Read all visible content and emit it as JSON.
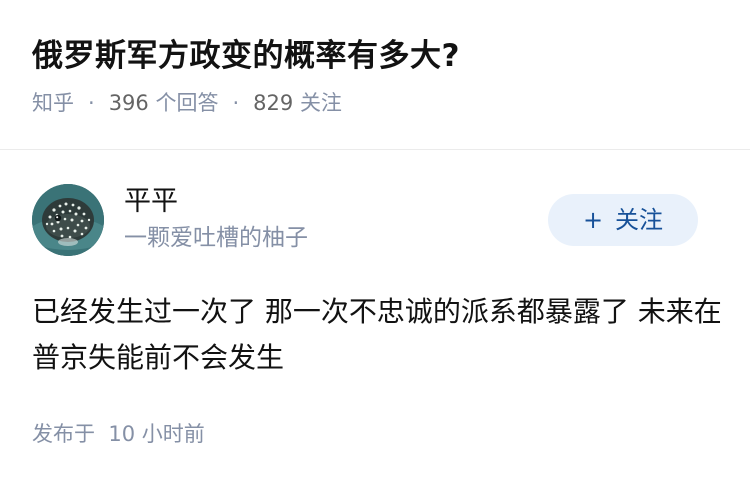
{
  "question": {
    "title": "俄罗斯军方政变的概率有多大?",
    "source": "知乎",
    "separator": "·",
    "answer_count": "396",
    "answer_label": "个回答",
    "follower_count": "829",
    "follower_label": "关注"
  },
  "answer": {
    "author": {
      "name": "平平",
      "bio": "一颗爱吐槽的柚子",
      "avatar_icon": "pufferfish-avatar"
    },
    "follow_button": {
      "plus": "+",
      "label": "关注"
    },
    "content": "已经发生过一次了 那一次不忠诚的派系都暴露了 未来在普京失能前不会发生",
    "published_label": "发布于",
    "published_time": "10 小时前"
  },
  "colors": {
    "title": "#121212",
    "meta": "#8590a6",
    "follow_bg": "#e9f1fb",
    "follow_text": "#175199",
    "divider": "#ebebeb"
  }
}
